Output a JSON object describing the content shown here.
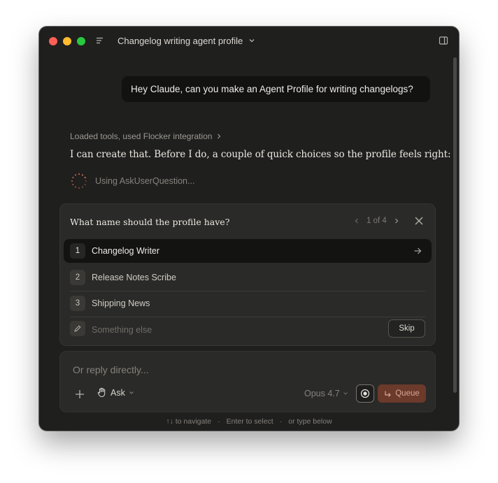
{
  "window": {
    "title": "Changelog writing agent profile"
  },
  "conversation": {
    "user_message": "Hey Claude, can you make an Agent Profile for writing changelogs?",
    "tools_summary": "Loaded tools, used Flocker integration",
    "assistant_text": "I can create that. Before I do, a couple of quick choices so the profile feels right:",
    "tool_status": "Using AskUserQuestion..."
  },
  "question": {
    "prompt": "What name should the profile have?",
    "pager": "1 of 4",
    "options": [
      {
        "num": "1",
        "label": "Changelog Writer"
      },
      {
        "num": "2",
        "label": "Release Notes Scribe"
      },
      {
        "num": "3",
        "label": "Shipping News"
      }
    ],
    "other_placeholder": "Something else",
    "skip_label": "Skip"
  },
  "reply": {
    "placeholder": "Or reply directly...",
    "mode_label": "Ask",
    "model_label": "Opus 4.7",
    "queue_label": "Queue"
  },
  "hints": {
    "navigate": "↑↓ to navigate",
    "select": "Enter to select",
    "type": "or type below"
  },
  "colors": {
    "window_bg": "#1f1f1e",
    "accent_queue": "#6b3a2b",
    "spinner": "#d97757"
  }
}
